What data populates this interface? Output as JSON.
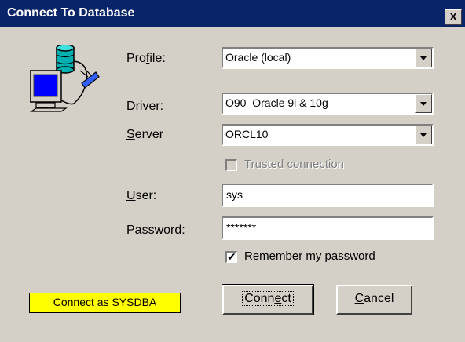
{
  "window": {
    "title": "Connect To Database",
    "close_label": "X"
  },
  "icon": "database-computer-icon",
  "fields": {
    "profile": {
      "label_pre": "Pro",
      "label_accel": "f",
      "label_post": "ile:",
      "value": "Oracle (local)"
    },
    "driver": {
      "label_pre": "",
      "label_accel": "D",
      "label_post": "river:",
      "value": "O90  Oracle 9i & 10g"
    },
    "server": {
      "label_pre": "",
      "label_accel": "S",
      "label_post": "erver",
      "value": "ORCL10"
    },
    "trusted": {
      "label": "Trusted connection",
      "checked": false,
      "enabled": false
    },
    "user": {
      "label_pre": "",
      "label_accel": "U",
      "label_post": "ser:",
      "value": "sys"
    },
    "password": {
      "label_pre": "",
      "label_accel": "P",
      "label_post": "assword:",
      "value": "*******"
    },
    "remember": {
      "label": "Remember my password",
      "checked": true
    }
  },
  "status_badge": "Connect as SYSDBA",
  "buttons": {
    "connect": {
      "pre": "Conn",
      "accel": "e",
      "post": "ct"
    },
    "cancel": {
      "pre": "",
      "accel": "C",
      "post": "ancel"
    }
  }
}
